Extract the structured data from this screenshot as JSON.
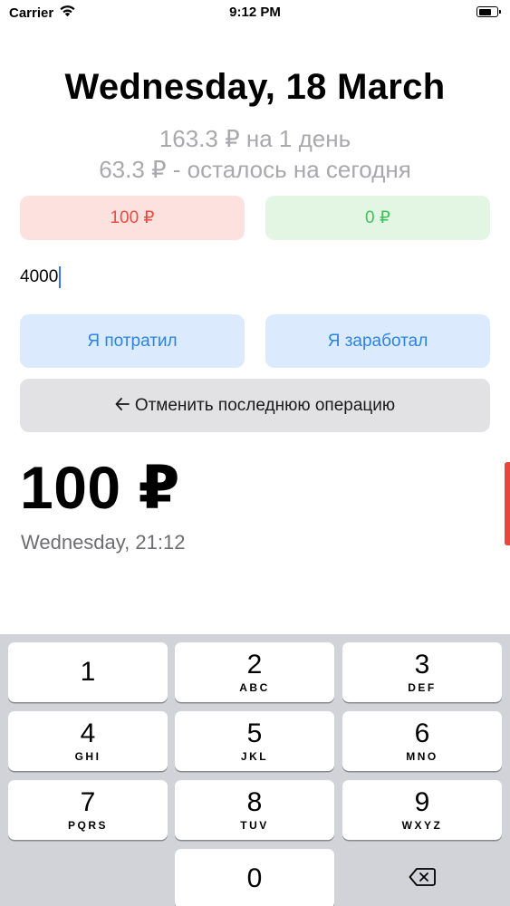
{
  "status_bar": {
    "carrier": "Carrier",
    "time": "9:12 PM",
    "icons": [
      "wifi-icon",
      "battery-icon"
    ]
  },
  "header": {
    "date": "Wednesday, 18 March",
    "daily_limit": "163.3 ₽ на 1 день",
    "remaining_today": "63.3 ₽ - осталось на сегодня"
  },
  "totals": {
    "spent": "100 ₽",
    "earned": "0 ₽",
    "spent_color": "#ea4d3d",
    "earned_color": "#3fc15b"
  },
  "amount_input": {
    "value": "4000"
  },
  "actions": {
    "spent_label": "Я потратил",
    "earned_label": "Я заработал",
    "undo_label": "Отменить последнюю операцию",
    "undo_icon": "arrow-left-icon"
  },
  "last_operation": {
    "amount": "100 ₽",
    "time": "Wednesday, 21:12"
  },
  "keyboard": {
    "keys": [
      {
        "digit": "1",
        "letters": ""
      },
      {
        "digit": "2",
        "letters": "ABC"
      },
      {
        "digit": "3",
        "letters": "DEF"
      },
      {
        "digit": "4",
        "letters": "GHI"
      },
      {
        "digit": "5",
        "letters": "JKL"
      },
      {
        "digit": "6",
        "letters": "MNO"
      },
      {
        "digit": "7",
        "letters": "PQRS"
      },
      {
        "digit": "8",
        "letters": "TUV"
      },
      {
        "digit": "9",
        "letters": "WXYZ"
      },
      {
        "digit": "0",
        "letters": ""
      }
    ],
    "backspace_icon": "backspace-icon"
  },
  "colors": {
    "accent": "#2b84e3",
    "scroll_indicator": "#e8463a"
  }
}
